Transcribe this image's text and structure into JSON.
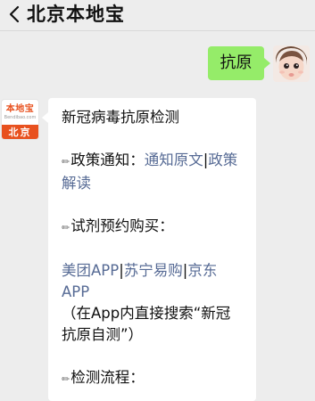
{
  "header": {
    "title": "北京本地宝"
  },
  "outgoing": {
    "text": "抗原"
  },
  "incoming": {
    "avatar": {
      "logo_text": "本地宝",
      "logo_sub": "Bendibao.com",
      "city": "北京"
    },
    "title": "新冠病毒抗原检测",
    "policy_label": "政策通知：",
    "link_notice": "通知原文",
    "sep1": "|",
    "link_policy": "政策解读",
    "buy_label": "试剂预约购买：",
    "link_meituan": "美团APP",
    "sep2": "|",
    "link_suning": "苏宁易购",
    "sep3": "|",
    "link_jd": "京东APP",
    "search_hint": "（在App内直接搜索“新冠抗原自测”）",
    "flow_label": "检测流程："
  },
  "icons": {
    "back": "chevron-left-icon",
    "note": "pencil-icon"
  },
  "colors": {
    "background": "#ededed",
    "outgoing_bubble": "#95ec69",
    "link": "#576b95",
    "logo_orange": "#e8511f"
  }
}
